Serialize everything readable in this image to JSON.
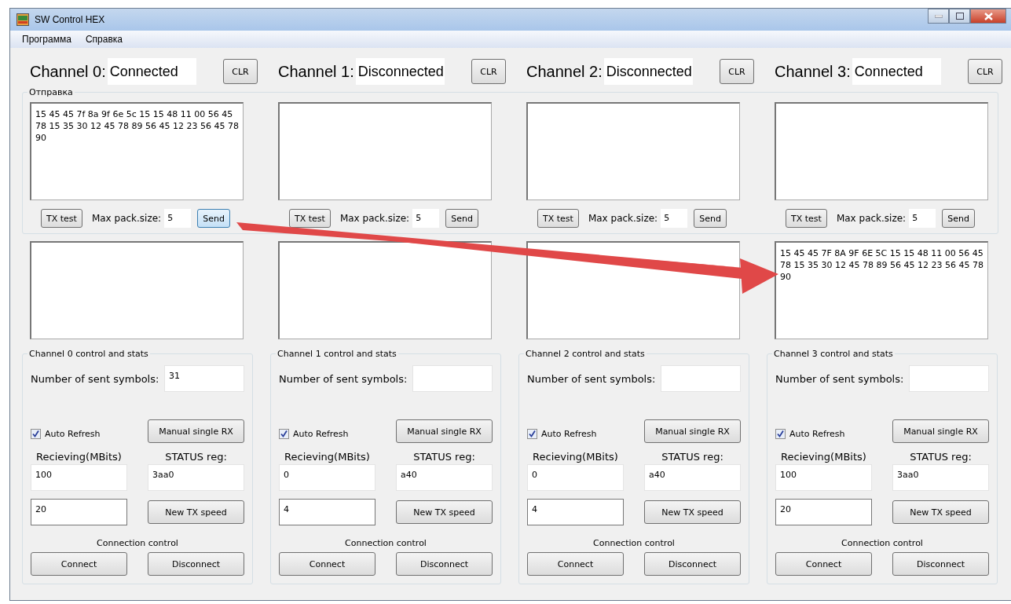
{
  "window": {
    "title": "SW Control HEX"
  },
  "menu": [
    {
      "label": "Программа"
    },
    {
      "label": "Справка"
    }
  ],
  "send_group": {
    "title": "Отправка"
  },
  "channels": [
    {
      "label": "Channel 0:",
      "status": "Connected",
      "clear": "CLR",
      "tx_text": "15 45 45 7f 8a 9f 6e 5c 15 15 48 11 00 56 45 78 15 35 30 12 45 78 89 56 45 12 23 56 45 78 90",
      "tx_test": "TX test",
      "max_pack_label": "Max pack.size:",
      "max_pack": "5",
      "send": {
        "label": "Send",
        "focused": true
      },
      "stats_title": "Channel 0 control and stats",
      "sent_label": "Number of sent symbols:",
      "sent_symbols": "31",
      "auto_refresh": {
        "label": "Auto Refresh",
        "checked": true
      },
      "manual_rx": "Manual single RX",
      "receiving_label": "Recieving(MBits)",
      "status_label": "STATUS reg:",
      "receiving": "100",
      "status_reg": "3aa0",
      "tx_speed": "20",
      "new_tx_speed": "New TX speed",
      "connection_label": "Connection control",
      "connect": "Connect",
      "disconnect": "Disconnect"
    },
    {
      "label": "Channel 1:",
      "status": "Disconnected",
      "clear": "CLR",
      "tx_test": "TX test",
      "max_pack_label": "Max pack.size:",
      "max_pack": "5",
      "send": {
        "label": "Send",
        "focused": false
      },
      "stats_title": "Channel 1 control and stats",
      "sent_label": "Number of sent symbols:",
      "auto_refresh": {
        "label": "Auto Refresh",
        "checked": true
      },
      "manual_rx": "Manual single RX",
      "receiving_label": "Recieving(MBits)",
      "status_label": "STATUS reg:",
      "receiving": "0",
      "status_reg": "a40",
      "tx_speed": "4",
      "new_tx_speed": "New TX speed",
      "connection_label": "Connection control",
      "connect": "Connect",
      "disconnect": "Disconnect"
    },
    {
      "label": "Channel 2:",
      "status": "Disconnected",
      "clear": "CLR",
      "tx_test": "TX test",
      "max_pack_label": "Max pack.size:",
      "max_pack": "5",
      "send": {
        "label": "Send",
        "focused": false
      },
      "stats_title": "Channel 2 control and stats",
      "sent_label": "Number of sent symbols:",
      "auto_refresh": {
        "label": "Auto Refresh",
        "checked": true
      },
      "manual_rx": "Manual single RX",
      "receiving_label": "Recieving(MBits)",
      "status_label": "STATUS reg:",
      "receiving": "0",
      "status_reg": "a40",
      "tx_speed": "4",
      "new_tx_speed": "New TX speed",
      "connection_label": "Connection control",
      "connect": "Connect",
      "disconnect": "Disconnect"
    },
    {
      "label": "Channel 3:",
      "status": "Connected",
      "clear": "CLR",
      "tx_test": "TX test",
      "max_pack_label": "Max pack.size:",
      "max_pack": "5",
      "send": {
        "label": "Send",
        "focused": false
      },
      "rx_text": "15 45 45 7F 8A 9F 6E 5C 15 15 48 11 00 56 45 78 15 35 30 12 45 78 89 56 45 12 23 56 45 78 90",
      "stats_title": "Channel 3 control and stats",
      "sent_label": "Number of sent symbols:",
      "auto_refresh": {
        "label": "Auto Refresh",
        "checked": true
      },
      "manual_rx": "Manual single RX",
      "receiving_label": "Recieving(MBits)",
      "status_label": "STATUS reg:",
      "receiving": "100",
      "status_reg": "3aa0",
      "tx_speed": "20",
      "new_tx_speed": "New TX speed",
      "connection_label": "Connection control",
      "connect": "Connect",
      "disconnect": "Disconnect"
    }
  ]
}
